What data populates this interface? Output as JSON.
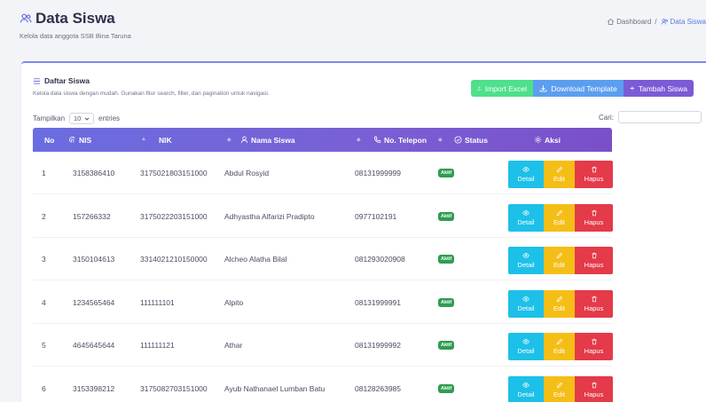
{
  "header": {
    "title": "Data Siswa",
    "subtitle": "Kelola data anggota SSB Bina Taruna",
    "breadcrumb": {
      "home": "Dashboard",
      "separator": "/",
      "current": "Data Siswa"
    }
  },
  "card": {
    "title": "Daftar Siswa",
    "description": "Kelola data siswa dengan mudah. Gunakan fitur search, filter, dan pagination untuk navigasi.",
    "buttons": {
      "import": "Import Excel",
      "download": "Download Template",
      "add": "Tambah Siswa"
    }
  },
  "table_controls": {
    "show_label": "Tampilkan",
    "page_length": "10",
    "entries_label": "entries",
    "search_label": "Cari:"
  },
  "columns": {
    "no": "No",
    "nis": "NIS",
    "nik": "NIK",
    "nama": "Nama Siswa",
    "telepon": "No. Telepon",
    "status": "Status",
    "aksi": "Aksi"
  },
  "action_labels": {
    "detail": "Detail",
    "edit": "Edit",
    "hapus": "Hapus"
  },
  "rows": [
    {
      "no": "1",
      "nis": "3158386410",
      "nik": "3175021803151000",
      "nama": "Abdul Rosyid",
      "telepon": "08131999999",
      "status": "Aktif"
    },
    {
      "no": "2",
      "nis": "157266332",
      "nik": "3175022203151000",
      "nama": "Adhyastha Alfarizi Pradipto",
      "telepon": "0977102191",
      "status": "Aktif"
    },
    {
      "no": "3",
      "nis": "3150104613",
      "nik": "3314021210150000",
      "nama": "Alcheo Alatha Bilal",
      "telepon": "081293020908",
      "status": "Aktif"
    },
    {
      "no": "4",
      "nis": "1234565464",
      "nik": "111111101",
      "nama": "Alpito",
      "telepon": "08131999991",
      "status": "Aktif"
    },
    {
      "no": "5",
      "nis": "4645645644",
      "nik": "111111121",
      "nama": "Athar",
      "telepon": "08131999992",
      "status": "Aktif"
    },
    {
      "no": "6",
      "nis": "3153398212",
      "nik": "3175082703151000",
      "nama": "Ayub Nathanael Lumban Batu",
      "telepon": "08128263985",
      "status": "Aktif"
    }
  ]
}
